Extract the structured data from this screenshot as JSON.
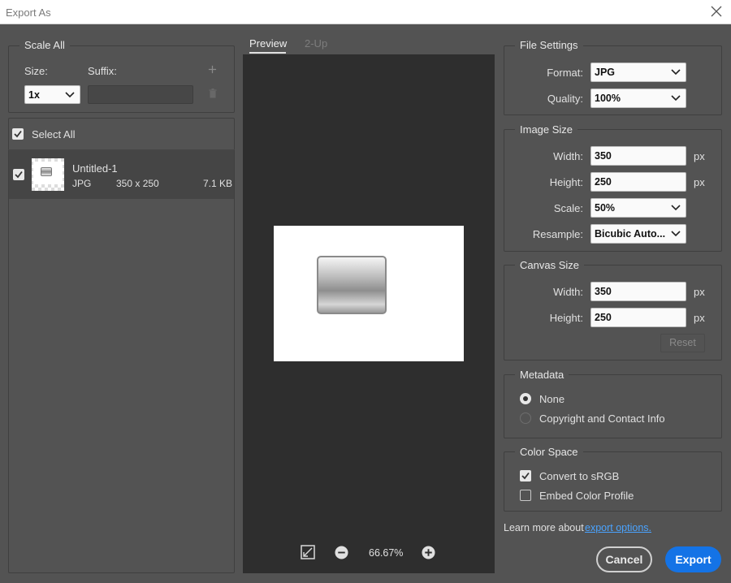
{
  "window": {
    "title": "Export As"
  },
  "scale_all": {
    "legend": "Scale All",
    "size_label": "Size:",
    "suffix_label": "Suffix:",
    "size_value": "1x",
    "suffix_value": ""
  },
  "select_all": {
    "label": "Select All",
    "checked": true
  },
  "assets": [
    {
      "name": "Untitled-1",
      "format": "JPG",
      "dimensions": "350 x 250",
      "file_size": "7.1 KB",
      "checked": true
    }
  ],
  "preview": {
    "tabs": [
      {
        "label": "Preview",
        "active": true
      },
      {
        "label": "2-Up",
        "active": false
      }
    ],
    "zoom": "66.67%"
  },
  "file_settings": {
    "legend": "File Settings",
    "format_label": "Format:",
    "format_value": "JPG",
    "quality_label": "Quality:",
    "quality_value": "100%"
  },
  "image_size": {
    "legend": "Image Size",
    "width_label": "Width:",
    "width_value": "350",
    "height_label": "Height:",
    "height_value": "250",
    "unit": "px",
    "scale_label": "Scale:",
    "scale_value": "50%",
    "resample_label": "Resample:",
    "resample_value": "Bicubic Auto..."
  },
  "canvas_size": {
    "legend": "Canvas Size",
    "width_label": "Width:",
    "width_value": "350",
    "height_label": "Height:",
    "height_value": "250",
    "unit": "px",
    "reset_label": "Reset"
  },
  "metadata": {
    "legend": "Metadata",
    "options": [
      {
        "label": "None",
        "selected": true
      },
      {
        "label": "Copyright and Contact Info",
        "selected": false
      }
    ]
  },
  "color_space": {
    "legend": "Color Space",
    "options": [
      {
        "label": "Convert to sRGB",
        "checked": true
      },
      {
        "label": "Embed Color Profile",
        "checked": false
      }
    ]
  },
  "footer": {
    "learn_more_text": "Learn more about",
    "learn_more_link": "export options.",
    "cancel_label": "Cancel",
    "export_label": "Export"
  },
  "colors": {
    "background": "#535353",
    "preview_bg": "#2e2e2e",
    "accent": "#1473e6",
    "link": "#4aa3ff"
  }
}
